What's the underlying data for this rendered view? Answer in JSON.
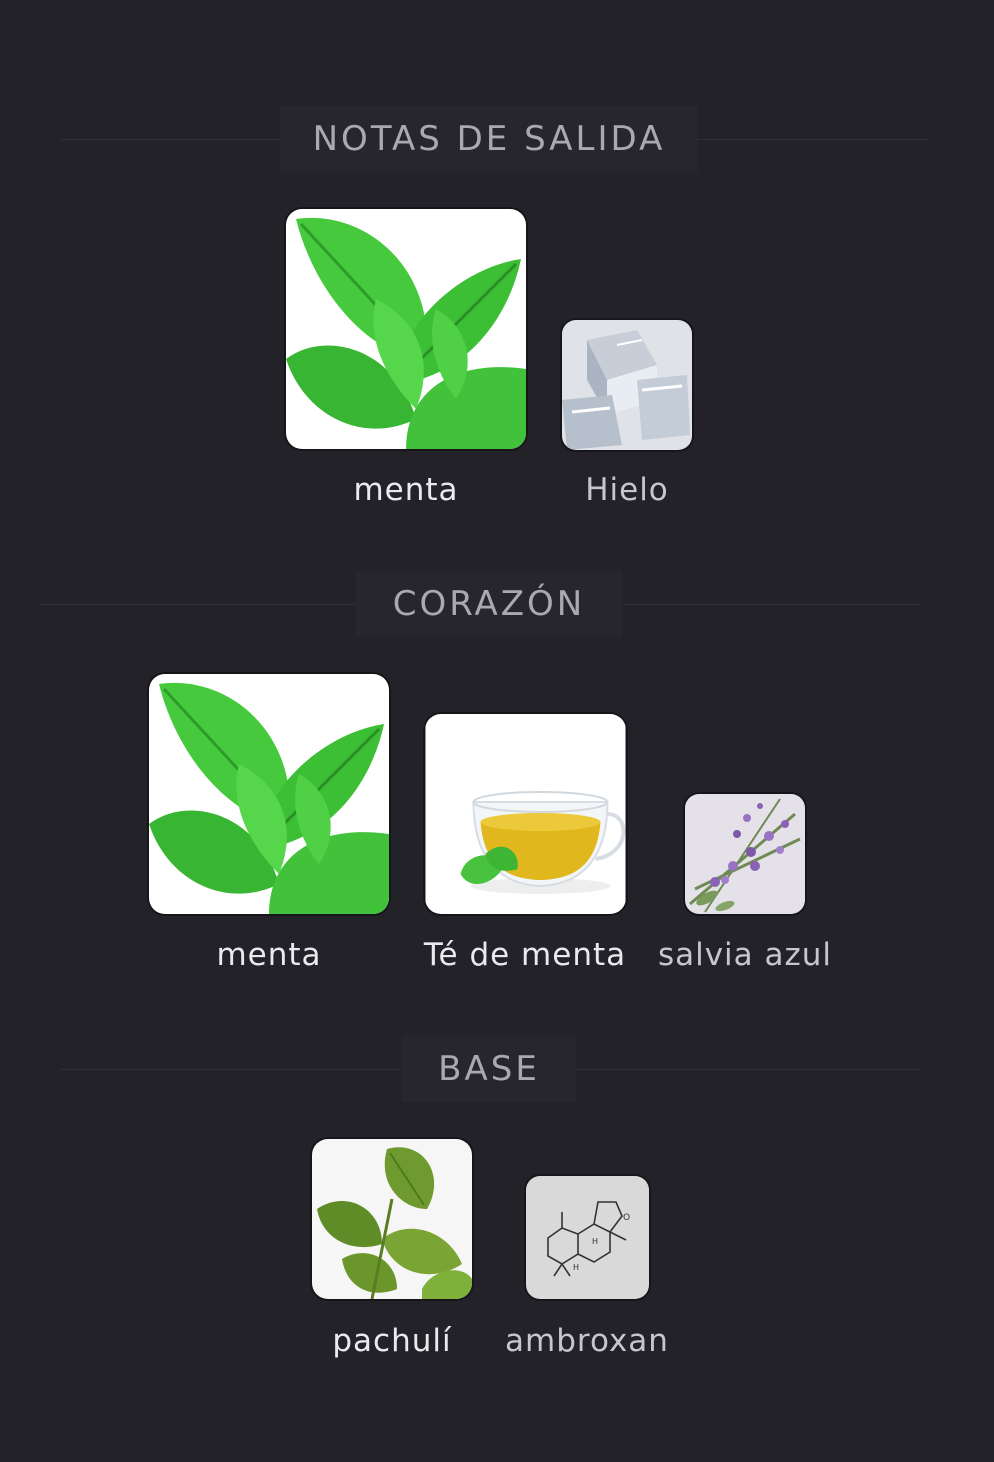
{
  "sections": {
    "top": {
      "title": "NOTAS DE SALIDA",
      "notes": [
        {
          "name": "menta",
          "icon": "mint-leaves-image"
        },
        {
          "name": "Hielo",
          "icon": "ice-cubes-image"
        }
      ]
    },
    "heart": {
      "title": "CORAZÓN",
      "notes": [
        {
          "name": "menta",
          "icon": "mint-leaves-image"
        },
        {
          "name": "Té de menta",
          "icon": "mint-tea-image"
        },
        {
          "name": "salvia azul",
          "icon": "blue-sage-image"
        }
      ]
    },
    "base": {
      "title": "BASE",
      "notes": [
        {
          "name": "pachulí",
          "icon": "patchouli-leaves-image"
        },
        {
          "name": "ambroxan",
          "icon": "ambroxan-molecule-image"
        }
      ]
    }
  },
  "colors": {
    "background": "#222228",
    "label_box": "#26262c",
    "mint": "#3fc53a",
    "caption": "#e9e9ee"
  }
}
